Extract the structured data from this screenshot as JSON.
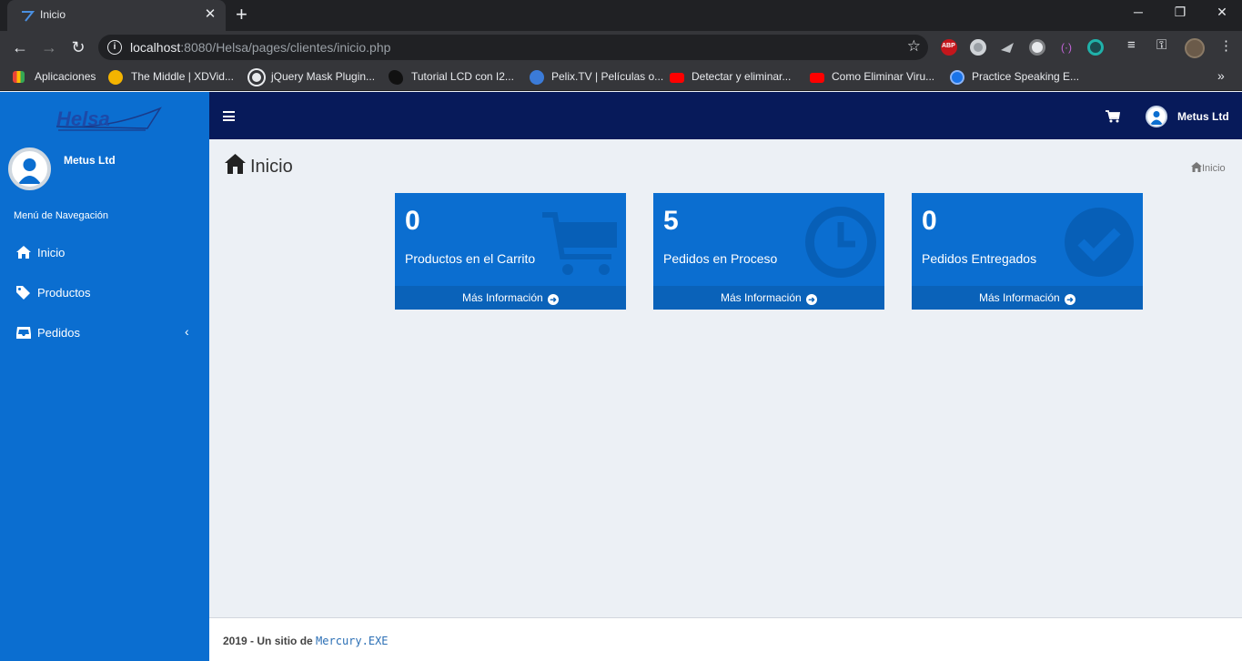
{
  "browser": {
    "tab_title": "Inicio",
    "url_host": "localhost",
    "url_path": ":8080/Helsa/pages/clientes/inicio.php",
    "bookmarks": [
      {
        "label": "Aplicaciones",
        "icon": "apps-grid-icon"
      },
      {
        "label": "The Middle | XDVid...",
        "icon": "xd-icon"
      },
      {
        "label": "jQuery Mask Plugin...",
        "icon": "globe-icon"
      },
      {
        "label": "Tutorial LCD con I2...",
        "icon": "bird-icon"
      },
      {
        "label": "Pelix.TV | Películas o...",
        "icon": "pelix-icon"
      },
      {
        "label": "Detectar y eliminar...",
        "icon": "youtube-icon"
      },
      {
        "label": "Como Eliminar Viru...",
        "icon": "youtube-icon"
      },
      {
        "label": "Practice Speaking E...",
        "icon": "circle-blue-icon"
      }
    ],
    "extensions": [
      "ABP",
      "circle-icon",
      "plane-icon",
      "disc-icon",
      "signal-icon",
      "target-icon"
    ]
  },
  "app": {
    "logo_text": "Helsa",
    "user_name": "Metus Ltd",
    "nav_header": "Menú de Navegación",
    "nav_items": [
      {
        "label": "Inicio",
        "icon": "home-icon"
      },
      {
        "label": "Productos",
        "icon": "tags-icon"
      },
      {
        "label": "Pedidos",
        "icon": "inbox-icon"
      }
    ],
    "top_user_name": "Metus Ltd",
    "page_title": "Inicio",
    "breadcrumb": "Inicio",
    "colors": {
      "sidebar": "#0b6ed0",
      "topbar": "#071a5a",
      "box": "#0b6ed0",
      "box_footer": "#0a62b9",
      "content_bg": "#ecf0f5"
    },
    "boxes": [
      {
        "value": "0",
        "label": "Productos en el Carrito",
        "link": "Más Información",
        "icon": "shopping-cart-icon"
      },
      {
        "value": "5",
        "label": "Pedidos en Proceso",
        "link": "Más Información",
        "icon": "clock-icon"
      },
      {
        "value": "0",
        "label": "Pedidos Entregados",
        "link": "Más Información",
        "icon": "check-circle-icon"
      }
    ],
    "footer": {
      "year": "2019",
      "text": " - Un sitio de ",
      "brand": "Mercury.EXE"
    }
  }
}
